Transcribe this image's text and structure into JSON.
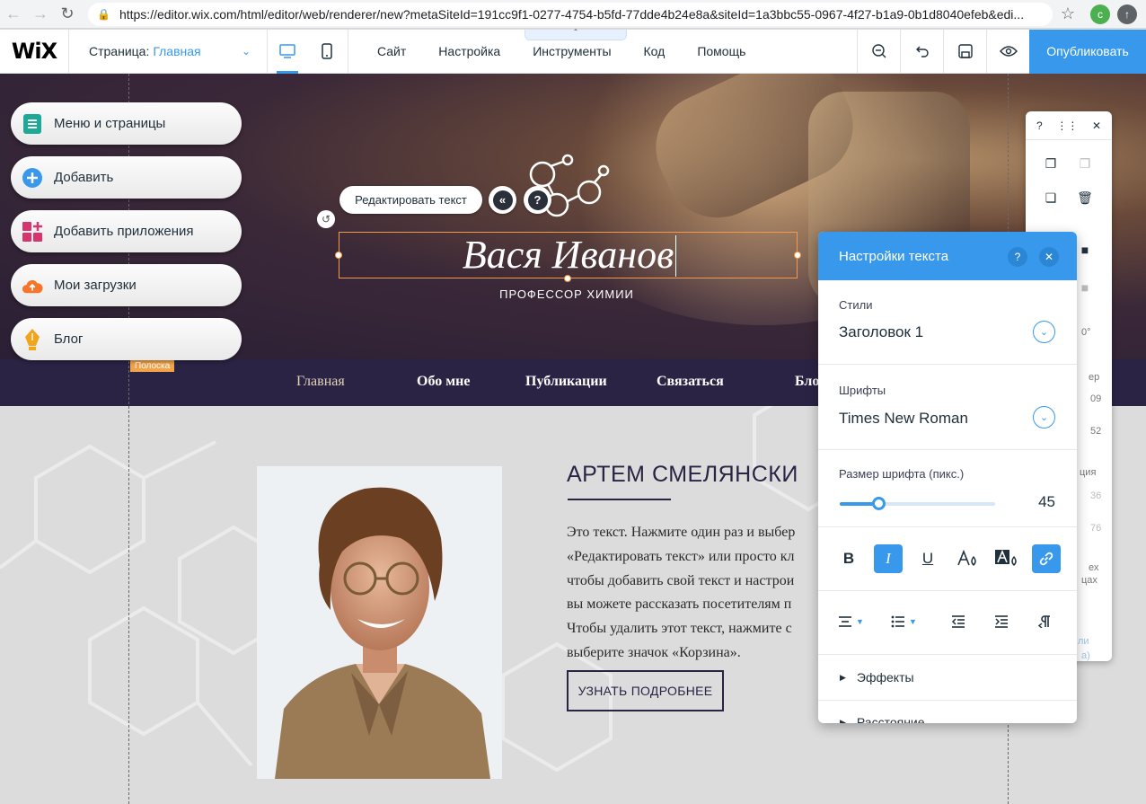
{
  "browser": {
    "url": "https://editor.wix.com/html/editor/web/renderer/new?metaSiteId=191cc9f1-0277-4754-b5fd-77dde4b24e8a&siteId=1a3bbc55-0967-4f27-b1a9-0b1d8040efeb&edi...",
    "profile_initial": "c"
  },
  "wix_bar": {
    "logo": "WiX",
    "page_label": "Страница:",
    "page_value": "Главная",
    "menu": [
      "Сайт",
      "Настройка",
      "Инструменты",
      "Код",
      "Помощь"
    ],
    "publish": "Опубликовать"
  },
  "left_panel": {
    "items": [
      {
        "label": "Меню и страницы",
        "icon": "pages-icon",
        "color": "#1ea896"
      },
      {
        "label": "Добавить",
        "icon": "add-icon",
        "color": "#3899ec"
      },
      {
        "label": "Добавить приложения",
        "icon": "apps-icon",
        "color": "#d6356e"
      },
      {
        "label": "Мои загрузки",
        "icon": "upload-cloud-icon",
        "color": "#f5762a"
      },
      {
        "label": "Блог",
        "icon": "pen-nib-icon",
        "color": "#f2a51a"
      }
    ]
  },
  "hero": {
    "edit_text_button": "Редактировать текст",
    "title": "Вася Иванов",
    "subtitle": "ПРОФЕССОР ХИМИИ",
    "strip_tag": "Полоска"
  },
  "site_nav": {
    "items": [
      "Главная",
      "Обо мне",
      "Публикации",
      "Связаться",
      "Бло"
    ]
  },
  "about": {
    "title": "АРТЕМ СМЕЛЯНСКИ",
    "lines": [
      "Это текст. Нажмите один раз и выбер",
      "«Редактировать текст» или просто кл",
      "чтобы добавить свой текст и настрои",
      "вы можете рассказать посетителям п",
      "Чтобы удалить этот текст, нажмите с",
      "выберите значок «Корзина»."
    ],
    "button": "УЗНАТЬ ПОДРОБНЕЕ"
  },
  "tool_strip": {
    "help": "?",
    "fragments": [
      "0°",
      "ер",
      "09",
      "52",
      "ция",
      "36",
      "76",
      "ех",
      "цах",
      "ли",
      "а)"
    ]
  },
  "text_settings": {
    "title": "Настройки текста",
    "help": "?",
    "styles_label": "Стили",
    "styles_value": "Заголовок 1",
    "fonts_label": "Шрифты",
    "fonts_value": "Times New Roman",
    "size_label": "Размер шрифта (пикс.)",
    "size_value": "45",
    "size_fraction": 0.25,
    "format": {
      "bold": "B",
      "italic": "I",
      "underline": "U"
    },
    "effects": "Эффекты",
    "spacing": "Расстояние"
  }
}
